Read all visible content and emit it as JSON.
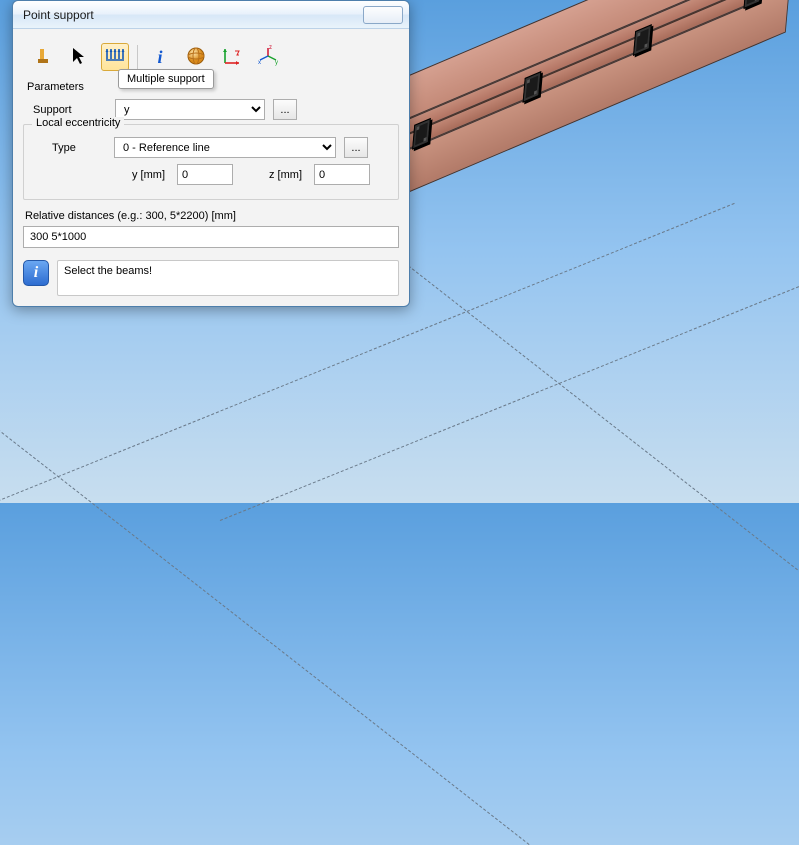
{
  "dialog": {
    "title": "Point support",
    "tooltip": "Multiple support",
    "section_parameters": "Parameters",
    "support_label": "Support",
    "support_value": "y",
    "browse_label": "...",
    "eccentricity": {
      "legend": "Local eccentricity",
      "type_label": "Type",
      "type_value": "0 - Reference line",
      "y_label": "y [mm]",
      "y_value": "0",
      "z_label": "z [mm]",
      "z_value": "0"
    },
    "distances": {
      "label": "Relative distances (e.g.: 300, 5*2200) [mm]",
      "value": "300 5*1000"
    },
    "hint": "Select the beams!"
  },
  "toolbar": {
    "icons": [
      "single-support-icon",
      "pointer-icon",
      "multiple-support-icon",
      "info-icon",
      "sphere-icon",
      "axis-icon",
      "coord-icon"
    ]
  }
}
